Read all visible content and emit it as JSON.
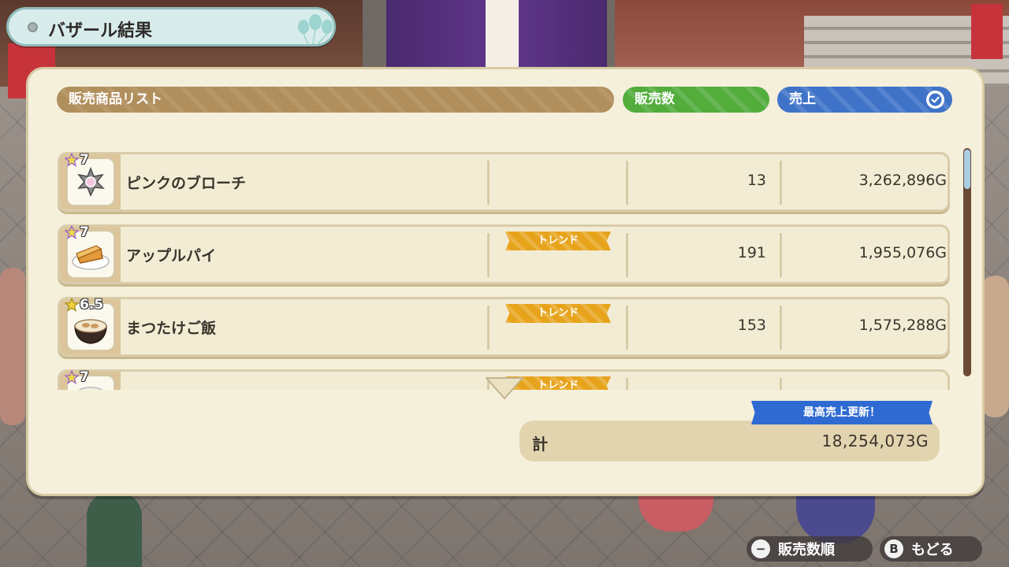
{
  "title": "バザール結果",
  "headers": {
    "list": "販売商品リスト",
    "quantity": "販売数",
    "sales": "売上"
  },
  "rows": [
    {
      "rarity": "7",
      "name": "ピンクのブローチ",
      "trend": "",
      "quantity": "13",
      "sales": "3,262,896G",
      "icon": "brooch-icon"
    },
    {
      "rarity": "7",
      "name": "アップルパイ",
      "trend": "トレンド",
      "quantity": "191",
      "sales": "1,955,076G",
      "icon": "apple-pie-icon"
    },
    {
      "rarity": "6.5",
      "name": "まつたけご飯",
      "trend": "トレンド",
      "quantity": "153",
      "sales": "1,575,288G",
      "icon": "rice-bowl-icon"
    },
    {
      "rarity": "7",
      "name": "",
      "trend": "トレンド",
      "quantity": "",
      "sales": "",
      "icon": "dish-icon"
    }
  ],
  "record_banner": "最高売上更新！",
  "total": {
    "label": "計",
    "value": "18,254,073G"
  },
  "controls": {
    "sort_button": "−",
    "sort_label": "販売数順",
    "back_button": "B",
    "back_label": "もどる"
  },
  "colors": {
    "list_header": "#b18f5c",
    "quantity_header": "#52ad3c",
    "sales_header": "#3f73c8",
    "trend_badge": "#e7a31b",
    "record_banner": "#2e6ad1"
  }
}
